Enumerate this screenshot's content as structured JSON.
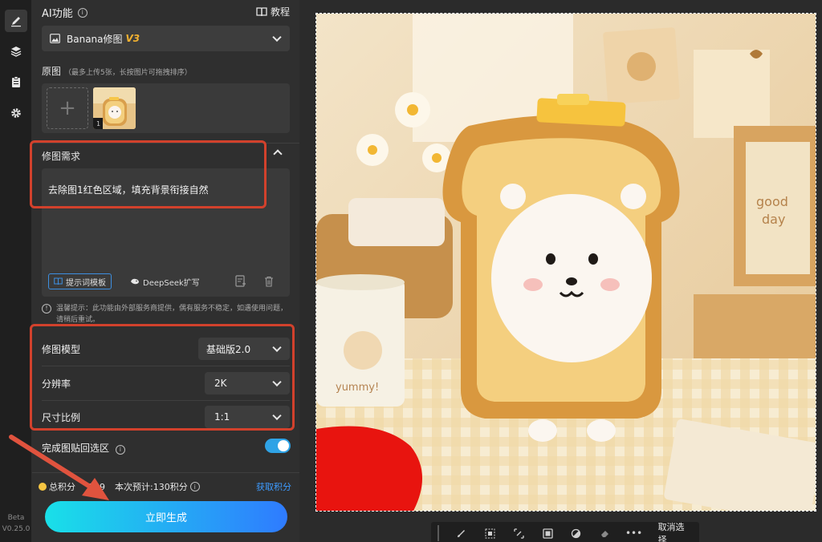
{
  "rail": {
    "version_line1": "Beta",
    "version_line2": "V0.25.0"
  },
  "panel": {
    "title": "AI功能",
    "tutorial": "教程",
    "model_select": {
      "name": "Banana修图",
      "badge": "V3"
    },
    "source": {
      "label": "原图",
      "hint": "（最多上传5张，长按图片可拖拽排序）",
      "thumb_index": "1"
    },
    "requirement": {
      "label": "修图需求",
      "text": "去除图1红色区域，填充背景衔接自然",
      "template_btn": "提示词模板",
      "deepseek_btn": "DeepSeek扩写"
    },
    "notice": "温馨提示：此功能由外部服务商提供，偶有服务不稳定，如遇使用问题，请稍后重试。",
    "settings": {
      "model": {
        "label": "修图模型",
        "value": "基础版2.0"
      },
      "resolution": {
        "label": "分辨率",
        "value": "2K"
      },
      "ratio": {
        "label": "尺寸比例",
        "value": "1:1"
      }
    },
    "paste_back": {
      "label": "完成图贴回选区",
      "enabled": true
    },
    "points": {
      "total_label": "总积分",
      "total_value": "239",
      "estimate": "本次预计:130积分",
      "get_points": "获取积分"
    },
    "generate": "立即生成"
  },
  "toolbar": {
    "cancel": "取消选择"
  },
  "canvas": {
    "cup_text": "yummy!",
    "card_text_1": "good",
    "card_text_2": "day"
  },
  "colors": {
    "accent": "#2f7bff",
    "highlight": "#d2412c",
    "mask": "#e8140f",
    "toggle": "#2fa3e6"
  }
}
